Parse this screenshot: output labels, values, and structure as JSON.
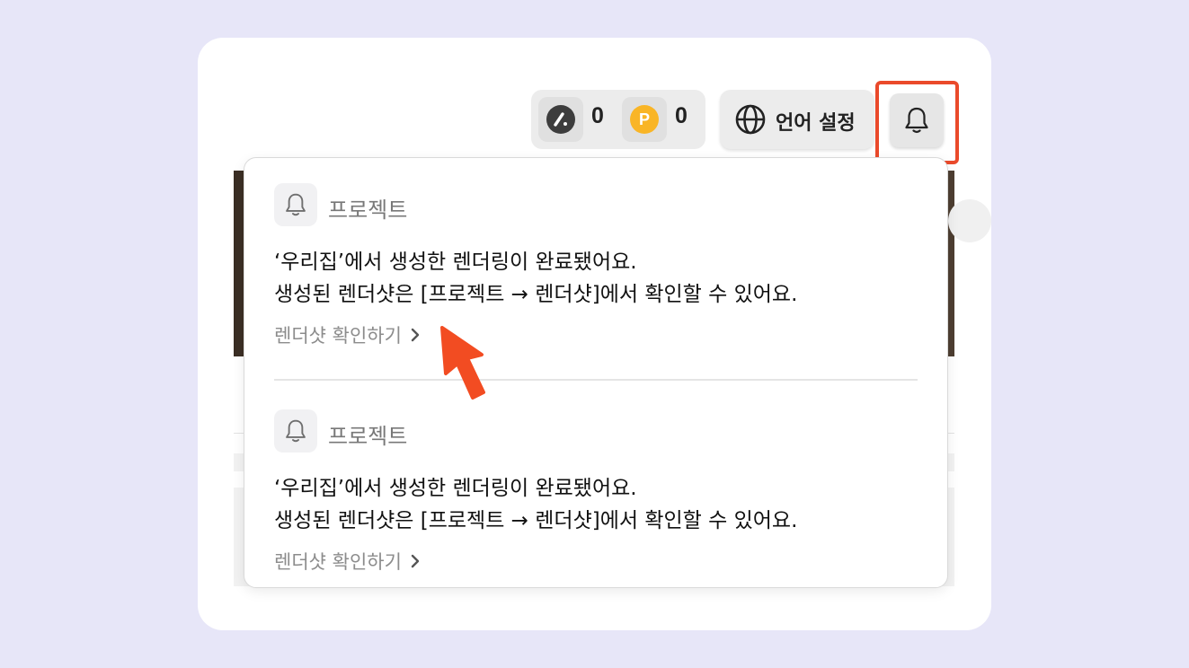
{
  "header": {
    "points": [
      {
        "icon": "logo-coin-icon",
        "color": "#3d3d3d",
        "value": "0"
      },
      {
        "icon": "p-coin-icon",
        "color": "#f9b526",
        "letter": "P",
        "value": "0"
      }
    ],
    "language_button": {
      "icon": "globe-icon",
      "label": "언어 설정"
    },
    "notifications_button": {
      "icon": "bell-icon",
      "highlight_color": "#ea4a2b"
    }
  },
  "notifications": [
    {
      "icon": "bell-icon",
      "category": "프로젝트",
      "line1": "‘우리집’에서 생성한 렌더링이 완료됐어요.",
      "line2": "생성된 렌더샷은 [프로젝트 → 렌더샷]에서 확인할 수 있어요.",
      "link": "렌더샷 확인하기"
    },
    {
      "icon": "bell-icon",
      "category": "프로젝트",
      "line1": "‘우리집’에서 생성한 렌더링이 완료됐어요.",
      "line2": "생성된 렌더샷은 [프로젝트 → 렌더샷]에서 확인할 수 있어요.",
      "link": "렌더샷 확인하기"
    }
  ],
  "annotation": {
    "pointer_color": "#f24c22"
  }
}
